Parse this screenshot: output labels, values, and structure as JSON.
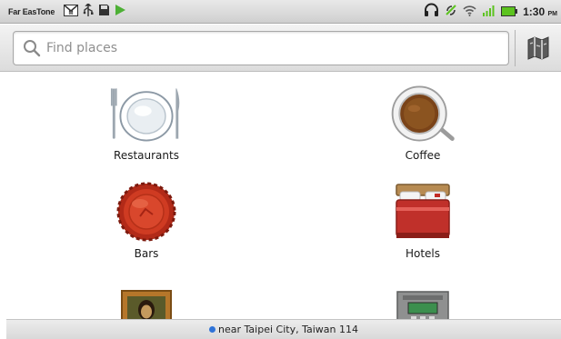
{
  "status_bar": {
    "carrier": "Far EasTone",
    "time": "1:30",
    "ampm": "PM",
    "left_icons": [
      "gmail-icon",
      "usb-icon",
      "sd-card-icon",
      "play-store-icon"
    ],
    "right_icons": [
      "headset-icon",
      "sync-icon",
      "wifi-icon",
      "signal-icon",
      "battery-icon"
    ]
  },
  "search": {
    "placeholder": "Find places"
  },
  "categories": [
    {
      "label": "Restaurants",
      "icon": "plate-icon"
    },
    {
      "label": "Coffee",
      "icon": "coffee-cup-icon"
    },
    {
      "label": "Bars",
      "icon": "bottle-cap-icon"
    },
    {
      "label": "Hotels",
      "icon": "bed-icon"
    },
    {
      "label": "",
      "icon": "painting-icon"
    },
    {
      "label": "",
      "icon": "atm-icon"
    }
  ],
  "footer": {
    "location_text": "near Taipei City, Taiwan 114"
  },
  "colors": {
    "location_dot": "#2f73d8",
    "signal_green": "#5cc31f"
  }
}
